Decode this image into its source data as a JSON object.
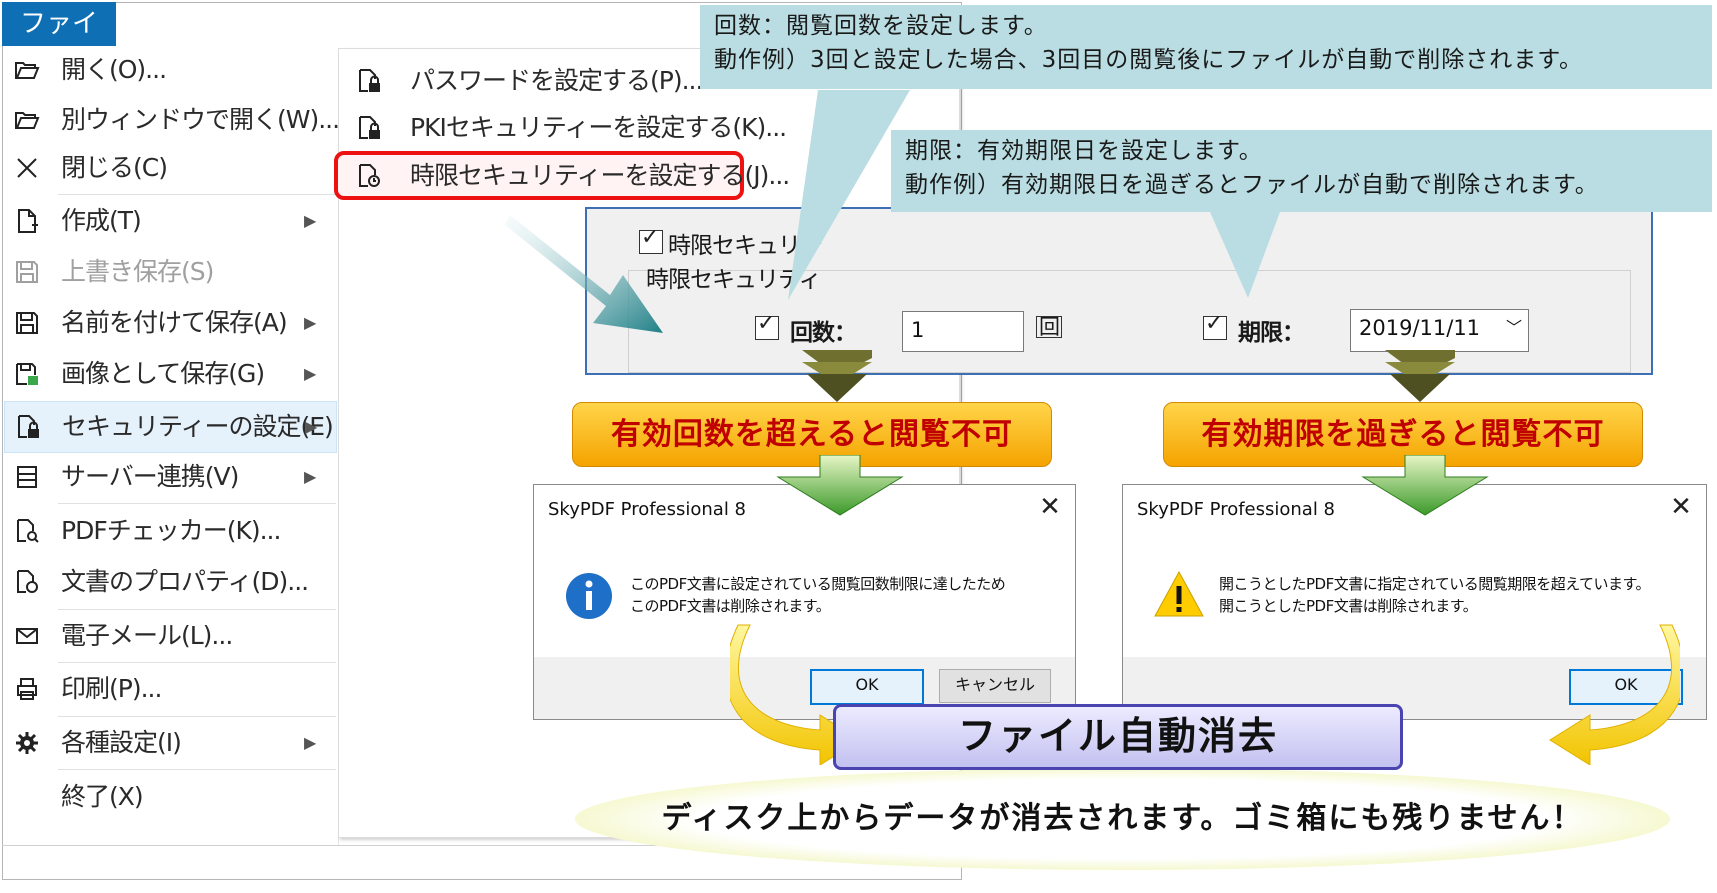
{
  "menu": {
    "tab_label": "ファイル",
    "items": [
      {
        "label": "開く(O)...",
        "icon": "folder-open-icon",
        "has_submenu": false,
        "disabled": false
      },
      {
        "label": "別ウィンドウで開く(W)...",
        "icon": "folder-open-window-icon",
        "has_submenu": false,
        "disabled": false
      },
      {
        "label": "閉じる(C)",
        "icon": "close-icon",
        "has_submenu": false,
        "disabled": false
      },
      {
        "label": "作成(T)",
        "icon": "new-document-icon",
        "has_submenu": true,
        "disabled": false
      },
      {
        "label": "上書き保存(S)",
        "icon": "save-icon",
        "has_submenu": false,
        "disabled": true
      },
      {
        "label": "名前を付けて保存(A)",
        "icon": "save-as-icon",
        "has_submenu": true,
        "disabled": false
      },
      {
        "label": "画像として保存(G)",
        "icon": "save-image-icon",
        "has_submenu": true,
        "disabled": false
      },
      {
        "label": "セキュリティーの設定(E)",
        "icon": "security-document-icon",
        "has_submenu": true,
        "disabled": false,
        "selected": true
      },
      {
        "label": "サーバー連携(V)",
        "icon": "server-icon",
        "has_submenu": true,
        "disabled": false
      },
      {
        "label": "PDFチェッカー(K)...",
        "icon": "pdf-checker-icon",
        "has_submenu": false,
        "disabled": false
      },
      {
        "label": "文書のプロパティ(D)...",
        "icon": "document-properties-icon",
        "has_submenu": false,
        "disabled": false
      },
      {
        "label": "電子メール(L)...",
        "icon": "mail-icon",
        "has_submenu": false,
        "disabled": false
      },
      {
        "label": "印刷(P)...",
        "icon": "printer-icon",
        "has_submenu": false,
        "disabled": false
      },
      {
        "label": "各種設定(I)",
        "icon": "gear-icon",
        "has_submenu": true,
        "disabled": false
      },
      {
        "label": "終了(X)",
        "icon": "",
        "has_submenu": false,
        "disabled": false
      }
    ],
    "submenu_arrow": "▶"
  },
  "submenu": {
    "items": [
      {
        "label": "パスワードを設定する(P)...",
        "icon": "password-lock-document-icon"
      },
      {
        "label": "PKIセキュリティーを設定する(K)...",
        "icon": "pki-lock-document-icon"
      },
      {
        "label": "時限セキュリティーを設定する(J)...",
        "icon": "timer-lock-document-icon",
        "highlighted": true
      }
    ]
  },
  "callouts": {
    "count": {
      "line1": "回数：閲覧回数を設定します。",
      "line2": "動作例）3回と設定した場合、3回目の閲覧後にファイルが自動で削除されます。"
    },
    "expiry": {
      "line1": "期限：有効期限日を設定します。",
      "line2": "動作例）有効期限日を過ぎるとファイルが自動で削除されます。"
    }
  },
  "settings": {
    "enable_label": "時限セキュリティーをかける(J)",
    "enable_label_visible": "時限セキュリテ",
    "group_label": "時限セキュリティ",
    "count_label": "回数：",
    "count_value": "1",
    "count_unit": "回",
    "expiry_label": "期限：",
    "expiry_value": "2019/11/11",
    "checkmark": "✓",
    "dropdown_glyph": "﹀"
  },
  "banners": {
    "left": "有効回数を超えると閲覧不可",
    "right": "有効期限を過ぎると閲覧不可"
  },
  "dialogs": {
    "left": {
      "title": "SkyPDF Professional 8",
      "close": "✕",
      "message_line1": "このPDF文書に設定されている閲覧回数制限に達したため",
      "message_line2": "このPDF文書は削除されます。",
      "icon": "info-icon",
      "ok_label": "OK",
      "cancel_label": "キャンセル"
    },
    "right": {
      "title": "SkyPDF Professional 8",
      "close": "✕",
      "message_line1": "開こうとしたPDF文書に指定されている閲覧期限を超えています。",
      "message_line2": "開こうとしたPDF文書は削除されます。",
      "icon": "warning-icon",
      "ok_label": "OK"
    }
  },
  "auto_delete": {
    "label": "ファイル自動消去",
    "message": "ディスク上からデータが消去されます。ゴミ箱にも残りません！"
  },
  "colors": {
    "tab_blue": "#0f6fb4",
    "highlight_red": "#e11111",
    "callout_bg": "#b9dde2",
    "banner_text": "#c00000",
    "banner_orange": "#f5a300",
    "auto_delete_border": "#4a44b0"
  }
}
